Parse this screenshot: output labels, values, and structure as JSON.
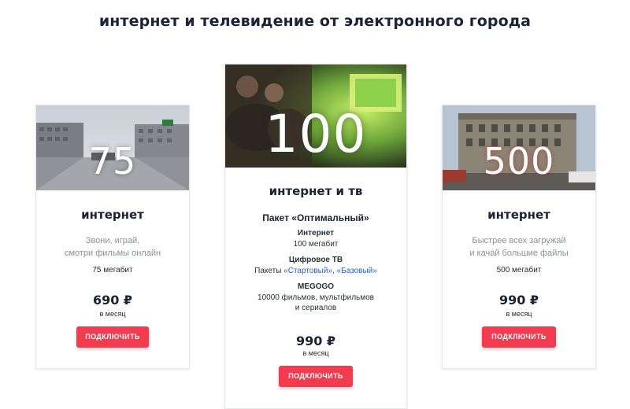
{
  "page": {
    "title": "интернет и телевидение от электронного города"
  },
  "plans": [
    {
      "number": "75",
      "heading": "интернет",
      "desc_line1": "Звони, играй,",
      "desc_line2": "смотри фильмы онлайн",
      "speed": "75 мегабит",
      "price": "690 ₽",
      "per_month": "в месяц",
      "button": "ПОДКЛЮЧИТЬ"
    },
    {
      "number": "100",
      "heading": "интернет и тв",
      "package": "Пакет «Оптимальный»",
      "internet_title": "Интернет",
      "internet_value": "100 мегабит",
      "tv_title": "Цифровое ТВ",
      "tv_prefix": "Пакеты ",
      "tv_link1": "«Стартовый»",
      "tv_sep": ", ",
      "tv_link2": "«Базовый»",
      "megogo_title": "MEGOGO",
      "megogo_line1": "10000 фильмов, мультфильмов",
      "megogo_line2": "и сериалов",
      "price": "990 ₽",
      "per_month": "в месяц",
      "button": "ПОДКЛЮЧИТЬ"
    },
    {
      "number": "500",
      "heading": "интернет",
      "desc_line1": "Быстрее всех загружай",
      "desc_line2": "и качай большие файлы",
      "speed": "500 мегабит",
      "price": "990 ₽",
      "per_month": "в месяц",
      "button": "ПОДКЛЮЧИТЬ"
    }
  ],
  "colors": {
    "accent": "#f23b4f",
    "link": "#2f5fb8",
    "heading": "#1a2438"
  },
  "icons": [
    "city-street-photo",
    "family-tv-photo",
    "city-building-photo"
  ]
}
